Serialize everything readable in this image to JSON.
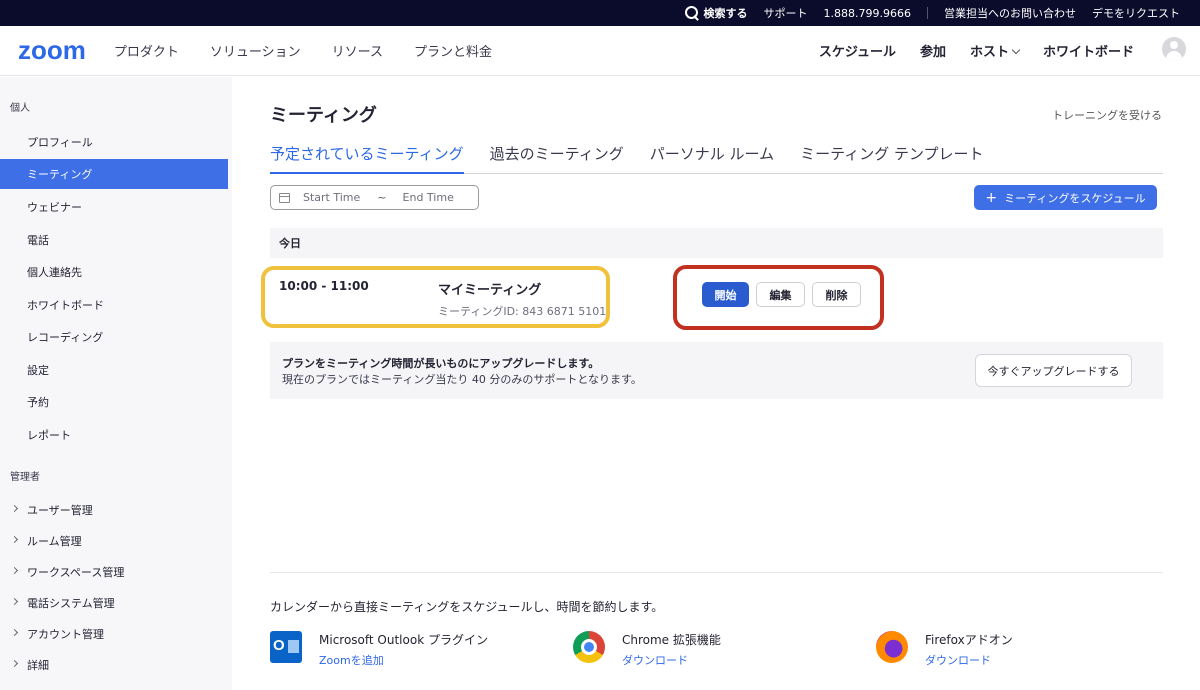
{
  "topbar": {
    "search": "検索する",
    "support": "サポート",
    "phone": "1.888.799.9666",
    "contact_sales": "営業担当へのお問い合わせ",
    "request_demo": "デモをリクエスト"
  },
  "nav": {
    "logo": "zoom",
    "left": [
      "プロダクト",
      "ソリューション",
      "リソース",
      "プランと料金"
    ],
    "schedule": "スケジュール",
    "join": "参加",
    "host": "ホスト",
    "whiteboard": "ホワイトボード"
  },
  "sidebar": {
    "personal_header": "個人",
    "personal": [
      "プロフィール",
      "ミーティング",
      "ウェビナー",
      "電話",
      "個人連絡先",
      "ホワイトボード",
      "レコーディング",
      "設定",
      "予約",
      "レポート"
    ],
    "admin_header": "管理者",
    "admin": [
      "ユーザー管理",
      "ルーム管理",
      "ワークスペース管理",
      "電話システム管理",
      "アカウント管理",
      "詳細"
    ]
  },
  "main": {
    "title": "ミーティング",
    "training": "トレーニングを受ける",
    "tabs": [
      "予定されているミーティング",
      "過去のミーティング",
      "パーソナル ルーム",
      "ミーティング テンプレート"
    ],
    "start_time_placeholder": "Start Time",
    "tilde": "~",
    "end_time_placeholder": "End Time",
    "schedule_button": "ミーティングをスケジュール",
    "today": "今日",
    "meeting": {
      "time": "10:00 - 11:00",
      "name": "マイミーティング",
      "id": "ミーティングID: 843 6871 5101"
    },
    "actions": {
      "start": "開始",
      "edit": "編集",
      "delete": "削除"
    },
    "upgrade": {
      "line1": "プランをミーティング時間が長いものにアップグレードします。",
      "line2": "現在のプランではミーティング当たり 40 分のみのサポートとなります。",
      "button": "今すぐアップグレードする"
    },
    "calendar_text": "カレンダーから直接ミーティングをスケジュールし、時間を節約します。",
    "plugins": [
      {
        "icon": "outlook-icon",
        "title": "Microsoft Outlook プラグイン",
        "link": "Zoomを追加"
      },
      {
        "icon": "chrome-icon",
        "title": "Chrome 拡張機能",
        "link": "ダウンロード"
      },
      {
        "icon": "firefox-icon",
        "title": "Firefoxアドオン",
        "link": "ダウンロード"
      }
    ]
  },
  "colors": {
    "brand": "#2d68e6",
    "highlight_yellow": "#f0c13c",
    "highlight_red": "#c2311f",
    "topbar_bg": "#0b0b2b"
  }
}
